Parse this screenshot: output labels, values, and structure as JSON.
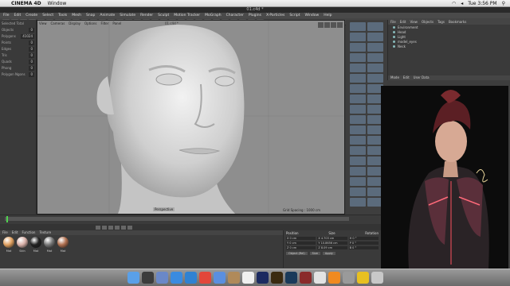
{
  "menubar": {
    "app": "CINEMA 4D",
    "items": [
      "Window"
    ],
    "clock": "Tue 3:56 PM"
  },
  "c4d": {
    "title": "01.c4d *",
    "menus": [
      "File",
      "Edit",
      "Create",
      "Select",
      "Tools",
      "Mesh",
      "Snap",
      "Animate",
      "Simulate",
      "Render",
      "Sculpt",
      "Motion Tracker",
      "MoGraph",
      "Character",
      "Plugins",
      "X-Particles",
      "Script",
      "Window",
      "Help"
    ]
  },
  "viewport": {
    "menus": [
      "View",
      "Cameras",
      "Display",
      "Options",
      "Filter",
      "Panel"
    ],
    "label": "Perspective",
    "grid_spacing": "Grid Spacing : 1000 cm"
  },
  "left_panel": {
    "header": "Selected Total",
    "rows": [
      {
        "k": "Objects",
        "v": "0"
      },
      {
        "k": "Polygons",
        "v": "41024"
      },
      {
        "k": "Points",
        "v": "0"
      },
      {
        "k": "Edges",
        "v": "0"
      },
      {
        "k": "Tris",
        "v": "0"
      },
      {
        "k": "Quads",
        "v": "0"
      },
      {
        "k": "Phong",
        "v": "0"
      },
      {
        "k": "Polygon Ngons",
        "v": "0"
      }
    ]
  },
  "object_manager": {
    "tabs": [
      "File",
      "Edit",
      "View",
      "Objects",
      "Tags",
      "Bookmarks"
    ],
    "objects": [
      "Environment",
      "Head",
      "Light",
      "model_eyes",
      "Neck"
    ],
    "footer_tabs": [
      "Mode",
      "Edit",
      "User Data"
    ]
  },
  "materials": {
    "menu": [
      "File",
      "Edit",
      "Function",
      "Texture"
    ],
    "items": [
      {
        "label": "Mat",
        "color": "#e0a060"
      },
      {
        "label": "Skin",
        "color": "#d8b0a8"
      },
      {
        "label": "Mat",
        "color": "#222222"
      },
      {
        "label": "Mat",
        "color": "#777777"
      },
      {
        "label": "Mat",
        "color": "#b07050"
      }
    ]
  },
  "coordinates": {
    "headers": [
      "Position",
      "Size",
      "Rotation"
    ],
    "rows": [
      [
        "X  0 cm",
        "X  4.703 cm",
        "H  0 °"
      ],
      [
        "Y  0 cm",
        "Y  10.8656 cm",
        "P  0 °"
      ],
      [
        "Z  0 cm",
        "Z  8.09 cm",
        "B  0 °"
      ]
    ],
    "mode": "Object (Rel)",
    "size_mode": "Size",
    "apply": "Apply"
  },
  "colors": {
    "viewport_bg": "#8e8e8e",
    "accent_green": "#4fd24f"
  },
  "dock": {
    "icons": [
      "finder-icon",
      "dashboard-icon",
      "mission-control-icon",
      "app-store-icon",
      "safari-icon",
      "chrome-icon",
      "mail-icon",
      "contacts-icon",
      "calendar-icon",
      "photoshop-icon",
      "illustrator-icon",
      "cinema4d-icon",
      "zbrush-icon",
      "itunes-icon",
      "vlc-icon",
      "preferences-icon",
      "radiation-icon",
      "trash-icon"
    ]
  }
}
